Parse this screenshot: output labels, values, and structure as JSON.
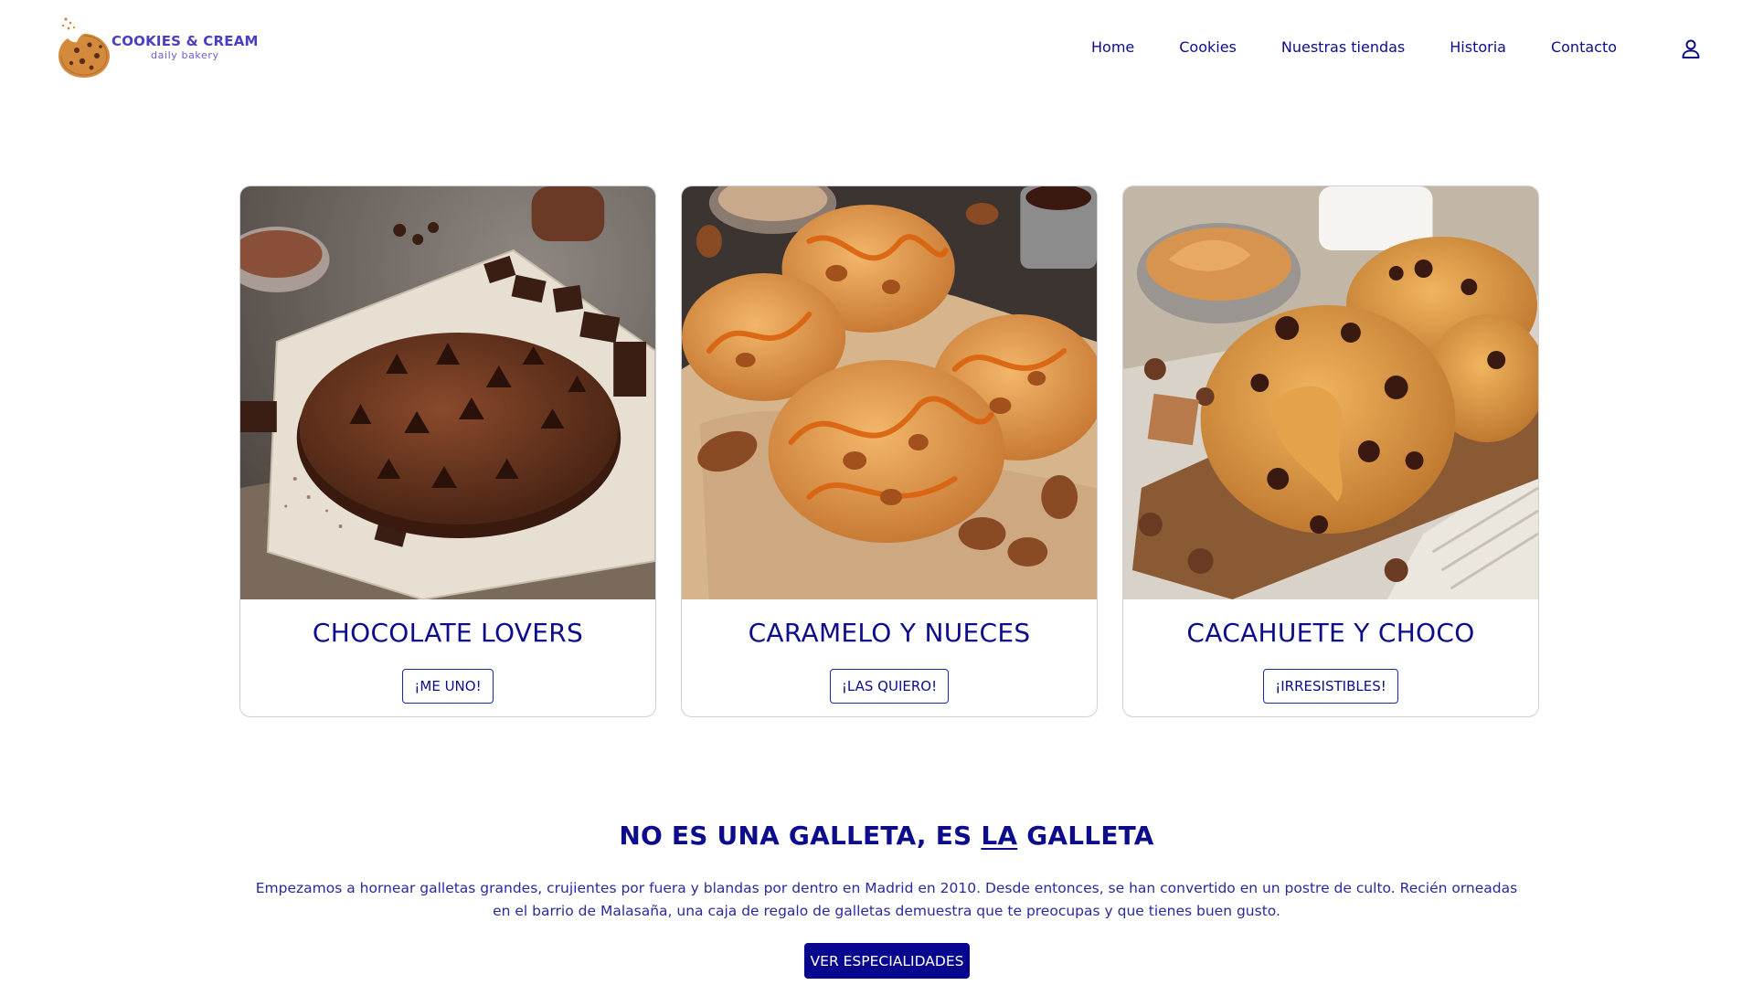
{
  "brand": {
    "name": "COOKIES & CREAM",
    "tagline": "daily bakery"
  },
  "nav": {
    "items": [
      "Home",
      "Cookies",
      "Nuestras tiendas",
      "Historia",
      "Contacto"
    ]
  },
  "cards": [
    {
      "title": "CHOCOLATE LOVERS",
      "button": "¡ME UNO!"
    },
    {
      "title": "CARAMELO Y NUECES",
      "button": "¡LAS QUIERO!"
    },
    {
      "title": "CACAHUETE Y CHOCO",
      "button": "¡IRRESISTIBLES!"
    }
  ],
  "about": {
    "title_before": "NO ES UNA GALLETA, ES ",
    "title_emph": "LA",
    "title_after": " GALLETA",
    "text": "Empezamos a hornear galletas grandes, crujientes por fuera y blandas por dentro en Madrid en 2010. Desde entonces, se han convertido en un postre de culto. Recién orneadas en el barrio de Malasaña, una caja de regalo de galletas demuestra que te preocupas y que tienes buen gusto.",
    "cta": "VER ESPECIALIDADES"
  },
  "icons": {
    "logo": "cookie-logo-icon",
    "user": "user-icon"
  },
  "colors": {
    "primary": "#0d0d8c",
    "cta_bg": "#06068f",
    "logo_text": "#4a3fc4"
  }
}
